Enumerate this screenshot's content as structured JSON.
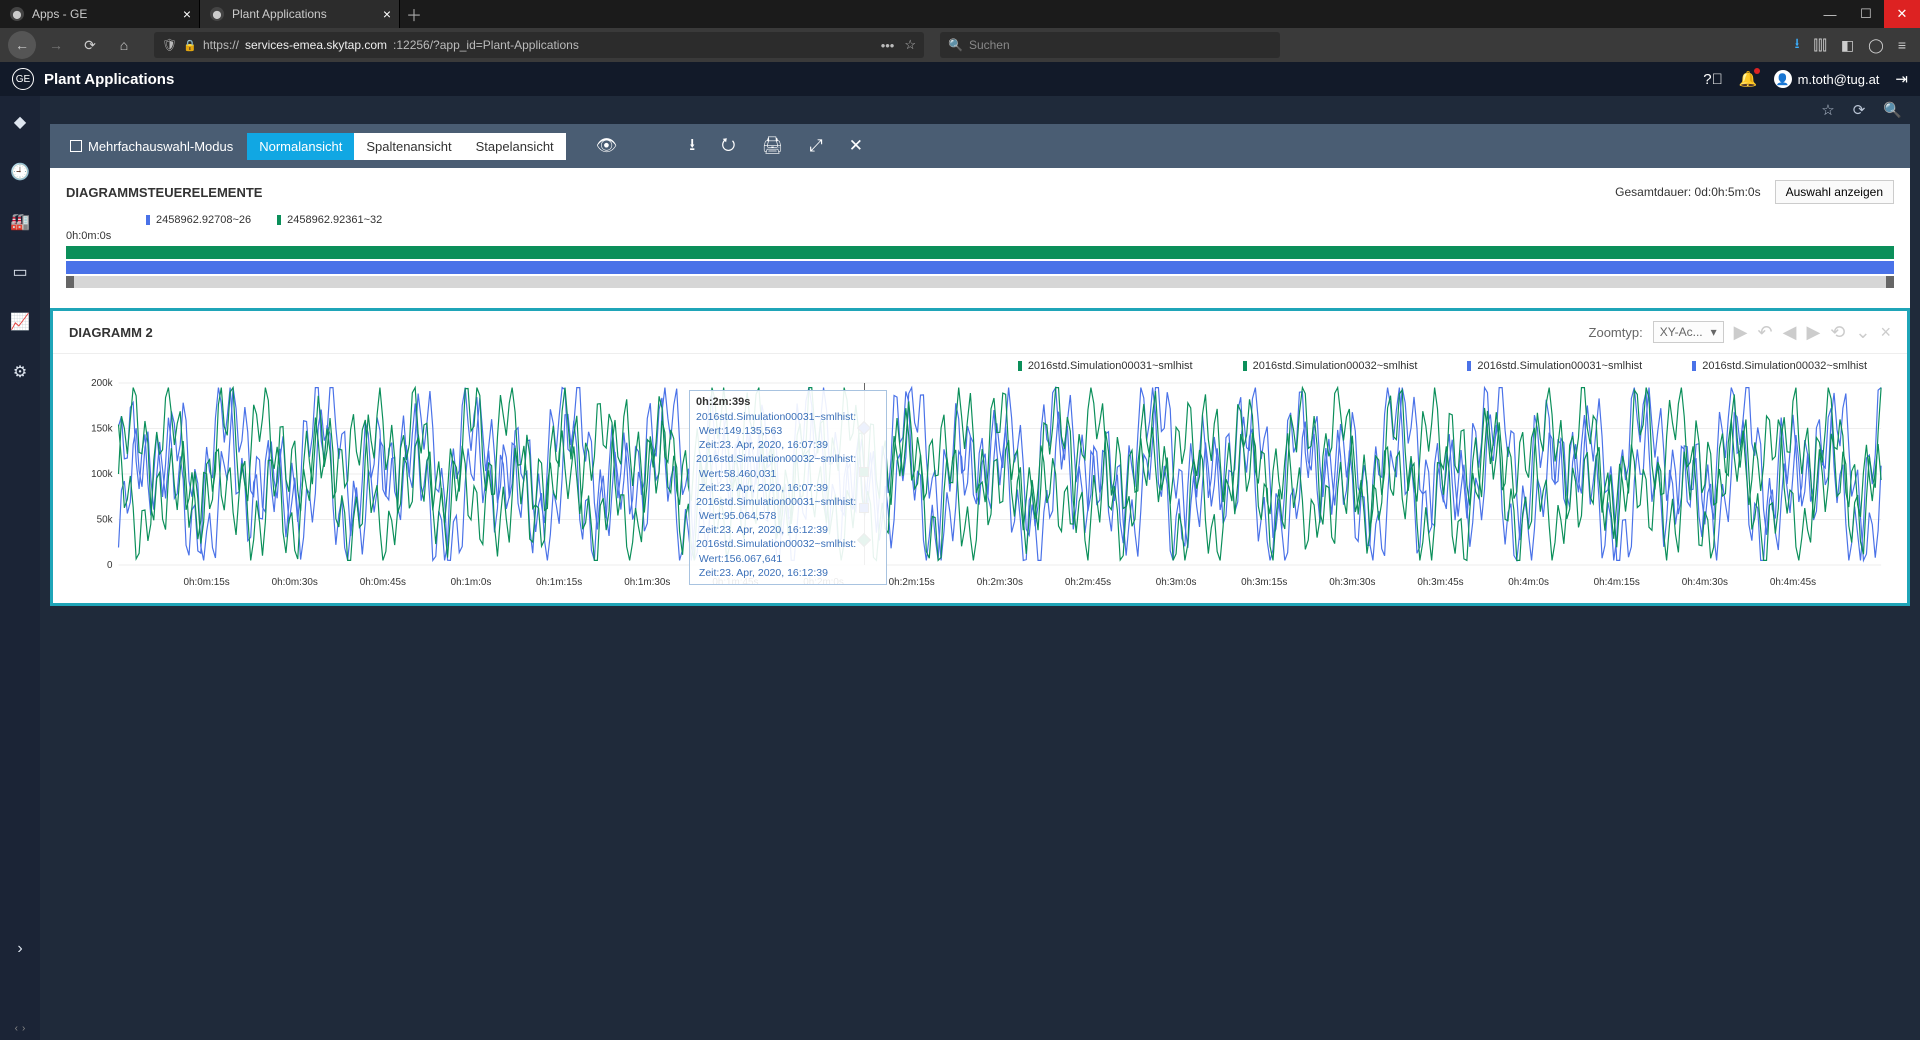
{
  "browser": {
    "tabs": [
      {
        "title": "Apps - GE",
        "active": false
      },
      {
        "title": "Plant Applications",
        "active": true
      }
    ],
    "url_prefix": "https://",
    "url_host": "services-emea.skytap.com",
    "url_port_path": ":12256/?app_id=Plant-Applications",
    "search_placeholder": "Suchen"
  },
  "app": {
    "title": "Plant Applications",
    "user": "m.toth@tug.at"
  },
  "toolbar": {
    "multi_select": "Mehrfachauswahl-Modus",
    "views": {
      "normal": "Normalansicht",
      "column": "Spaltenansicht",
      "stack": "Stapelansicht"
    }
  },
  "panel1": {
    "title": "DIAGRAMMSTEUERELEMENTE",
    "duration_label": "Gesamtdauer: 0d:0h:5m:0s",
    "show_selection": "Auswahl anzeigen",
    "legend": {
      "blue": "2458962.92708~26",
      "green": "2458962.92361~32"
    },
    "time_start": "0h:0m:0s"
  },
  "panel2": {
    "title": "DIAGRAMM 2",
    "zoom_label": "Zoomtyp:",
    "zoom_value": "XY-Ac...",
    "legend": [
      {
        "name": "2016std.Simulation00031~smlhist",
        "color": "green"
      },
      {
        "name": "2016std.Simulation00032~smlhist",
        "color": "green"
      },
      {
        "name": "2016std.Simulation00031~smlhist",
        "color": "blue"
      },
      {
        "name": "2016std.Simulation00032~smlhist",
        "color": "blue"
      }
    ]
  },
  "tooltip": {
    "time": "0h:2m:39s",
    "rows": [
      {
        "label": "2016std.Simulation00031~smlhist:",
        "wert": "Wert:149.135,563",
        "zeit": "Zeit:23. Apr, 2020, 16:07:39"
      },
      {
        "label": "2016std.Simulation00032~smlhist:",
        "wert": "Wert:58.460,031",
        "zeit": "Zeit:23. Apr, 2020, 16:07:39"
      },
      {
        "label": "2016std.Simulation00031~smlhist:",
        "wert": "Wert:95.064,578",
        "zeit": "Zeit:23. Apr, 2020, 16:12:39"
      },
      {
        "label": "2016std.Simulation00032~smlhist:",
        "wert": "Wert:156.067,641",
        "zeit": "Zeit:23. Apr, 2020, 16:12:39"
      }
    ]
  },
  "chart_data": {
    "type": "line",
    "xlabel": "",
    "ylabel": "",
    "ylim": [
      0,
      200000
    ],
    "y_ticks": [
      "0",
      "50k",
      "100k",
      "150k",
      "200k"
    ],
    "x_ticks": [
      "0h:0m:15s",
      "0h:0m:30s",
      "0h:0m:45s",
      "0h:1m:0s",
      "0h:1m:15s",
      "0h:1m:30s",
      "0h:1m:45s",
      "0h:2m:0s",
      "0h:2m:15s",
      "0h:2m:30s",
      "0h:2m:45s",
      "0h:3m:0s",
      "0h:3m:15s",
      "0h:3m:30s",
      "0h:3m:45s",
      "0h:4m:0s",
      "0h:4m:15s",
      "0h:4m:30s",
      "0h:4m:45s"
    ],
    "cursor_x_seconds": 159,
    "cursor_values": {
      "Simulation00031_smlhist_a": 149135.563,
      "Simulation00032_smlhist_a": 58460.031,
      "Simulation00031_smlhist_b": 95064.578,
      "Simulation00032_smlhist_b": 156067.641
    },
    "note": "Dense oscillating time-series ~0–200k over 0–5 min; individual samples not labeled in source image, values estimated from tooltip at cursor only."
  }
}
